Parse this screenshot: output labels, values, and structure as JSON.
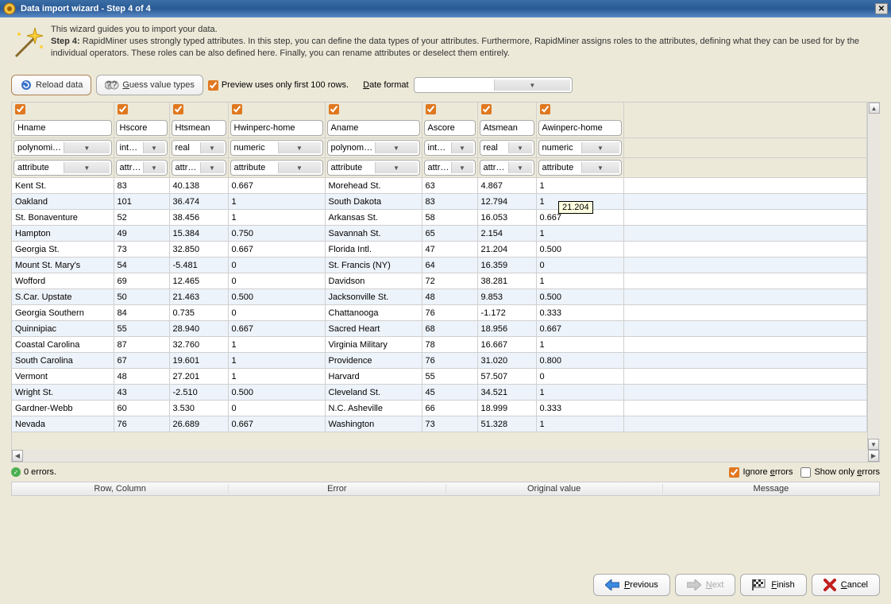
{
  "title": "Data import wizard - Step 4 of 4",
  "intro": {
    "line1": "This wizard guides you to import your data.",
    "step_label": "Step 4:",
    "line2": " RapidMiner uses strongly typed attributes. In this step, you can define the data types of your attributes. Furthermore, RapidMiner assigns roles to the attributes, defining what they can be used for by the individual operators. These roles can be also defined here. Finally, you can rename attributes or deselect them entirely."
  },
  "toolbar": {
    "reload": "Reload data",
    "guess": "Guess value types",
    "preview_label": "Preview uses only first 100 rows.",
    "dateformat_label": "Date format",
    "dateformat_value": ""
  },
  "columns": [
    {
      "name": "Hname",
      "type": "polynominal",
      "role": "attribute",
      "width_class": "c0"
    },
    {
      "name": "Hscore",
      "type": "integer",
      "role": "attribute",
      "width_class": "c1"
    },
    {
      "name": "Htsmean",
      "type": "real",
      "role": "attribute",
      "width_class": "c2"
    },
    {
      "name": "Hwinperc-home",
      "type": "numeric",
      "role": "attribute",
      "width_class": "c3"
    },
    {
      "name": "Aname",
      "type": "polynominal",
      "role": "attribute",
      "width_class": "c4"
    },
    {
      "name": "Ascore",
      "type": "integer",
      "role": "attribute",
      "width_class": "c5"
    },
    {
      "name": "Atsmean",
      "type": "real",
      "role": "attribute",
      "width_class": "c6"
    },
    {
      "name": "Awinperc-home",
      "type": "numeric",
      "role": "attribute",
      "width_class": "c7"
    }
  ],
  "rows": [
    [
      "Kent St.",
      "83",
      "40.138",
      "0.667",
      "Morehead St.",
      "63",
      "4.867",
      "1"
    ],
    [
      "Oakland",
      "101",
      "36.474",
      "1",
      "South Dakota",
      "83",
      "12.794",
      "1"
    ],
    [
      "St. Bonaventure",
      "52",
      "38.456",
      "1",
      "Arkansas St.",
      "58",
      "16.053",
      "0.667"
    ],
    [
      "Hampton",
      "49",
      "15.384",
      "0.750",
      "Savannah St.",
      "65",
      "2.154",
      "1"
    ],
    [
      "Georgia St.",
      "73",
      "32.850",
      "0.667",
      "Florida Intl.",
      "47",
      "21.204",
      "0.500"
    ],
    [
      "Mount St. Mary's",
      "54",
      "-5.481",
      "0",
      "St. Francis (NY)",
      "64",
      "16.359",
      "0"
    ],
    [
      "Wofford",
      "69",
      "12.465",
      "0",
      "Davidson",
      "72",
      "38.281",
      "1"
    ],
    [
      "S.Car. Upstate",
      "50",
      "21.463",
      "0.500",
      "Jacksonville St.",
      "48",
      "9.853",
      "0.500"
    ],
    [
      "Georgia Southern",
      "84",
      "0.735",
      "0",
      "Chattanooga",
      "76",
      "-1.172",
      "0.333"
    ],
    [
      "Quinnipiac",
      "55",
      "28.940",
      "0.667",
      "Sacred Heart",
      "68",
      "18.956",
      "0.667"
    ],
    [
      "Coastal Carolina",
      "87",
      "32.760",
      "1",
      "Virginia Military",
      "78",
      "16.667",
      "1"
    ],
    [
      "South Carolina",
      "67",
      "19.601",
      "1",
      "Providence",
      "76",
      "31.020",
      "0.800"
    ],
    [
      "Vermont",
      "48",
      "27.201",
      "1",
      "Harvard",
      "55",
      "57.507",
      "0"
    ],
    [
      "Wright St.",
      "43",
      "-2.510",
      "0.500",
      "Cleveland St.",
      "45",
      "34.521",
      "1"
    ],
    [
      "Gardner-Webb",
      "60",
      "3.530",
      "0",
      "N.C. Asheville",
      "66",
      "18.999",
      "0.333"
    ],
    [
      "Nevada",
      "76",
      "26.689",
      "0.667",
      "Washington",
      "73",
      "51.328",
      "1"
    ]
  ],
  "tooltip_value": "21.204",
  "errors": {
    "count_label": "0 errors.",
    "ignore_label": "Ignore errors",
    "showonly_label": "Show only errors",
    "headers": [
      "Row, Column",
      "Error",
      "Original value",
      "Message"
    ]
  },
  "buttons": {
    "previous": "Previous",
    "next": "Next",
    "finish": "Finish",
    "cancel": "Cancel"
  }
}
